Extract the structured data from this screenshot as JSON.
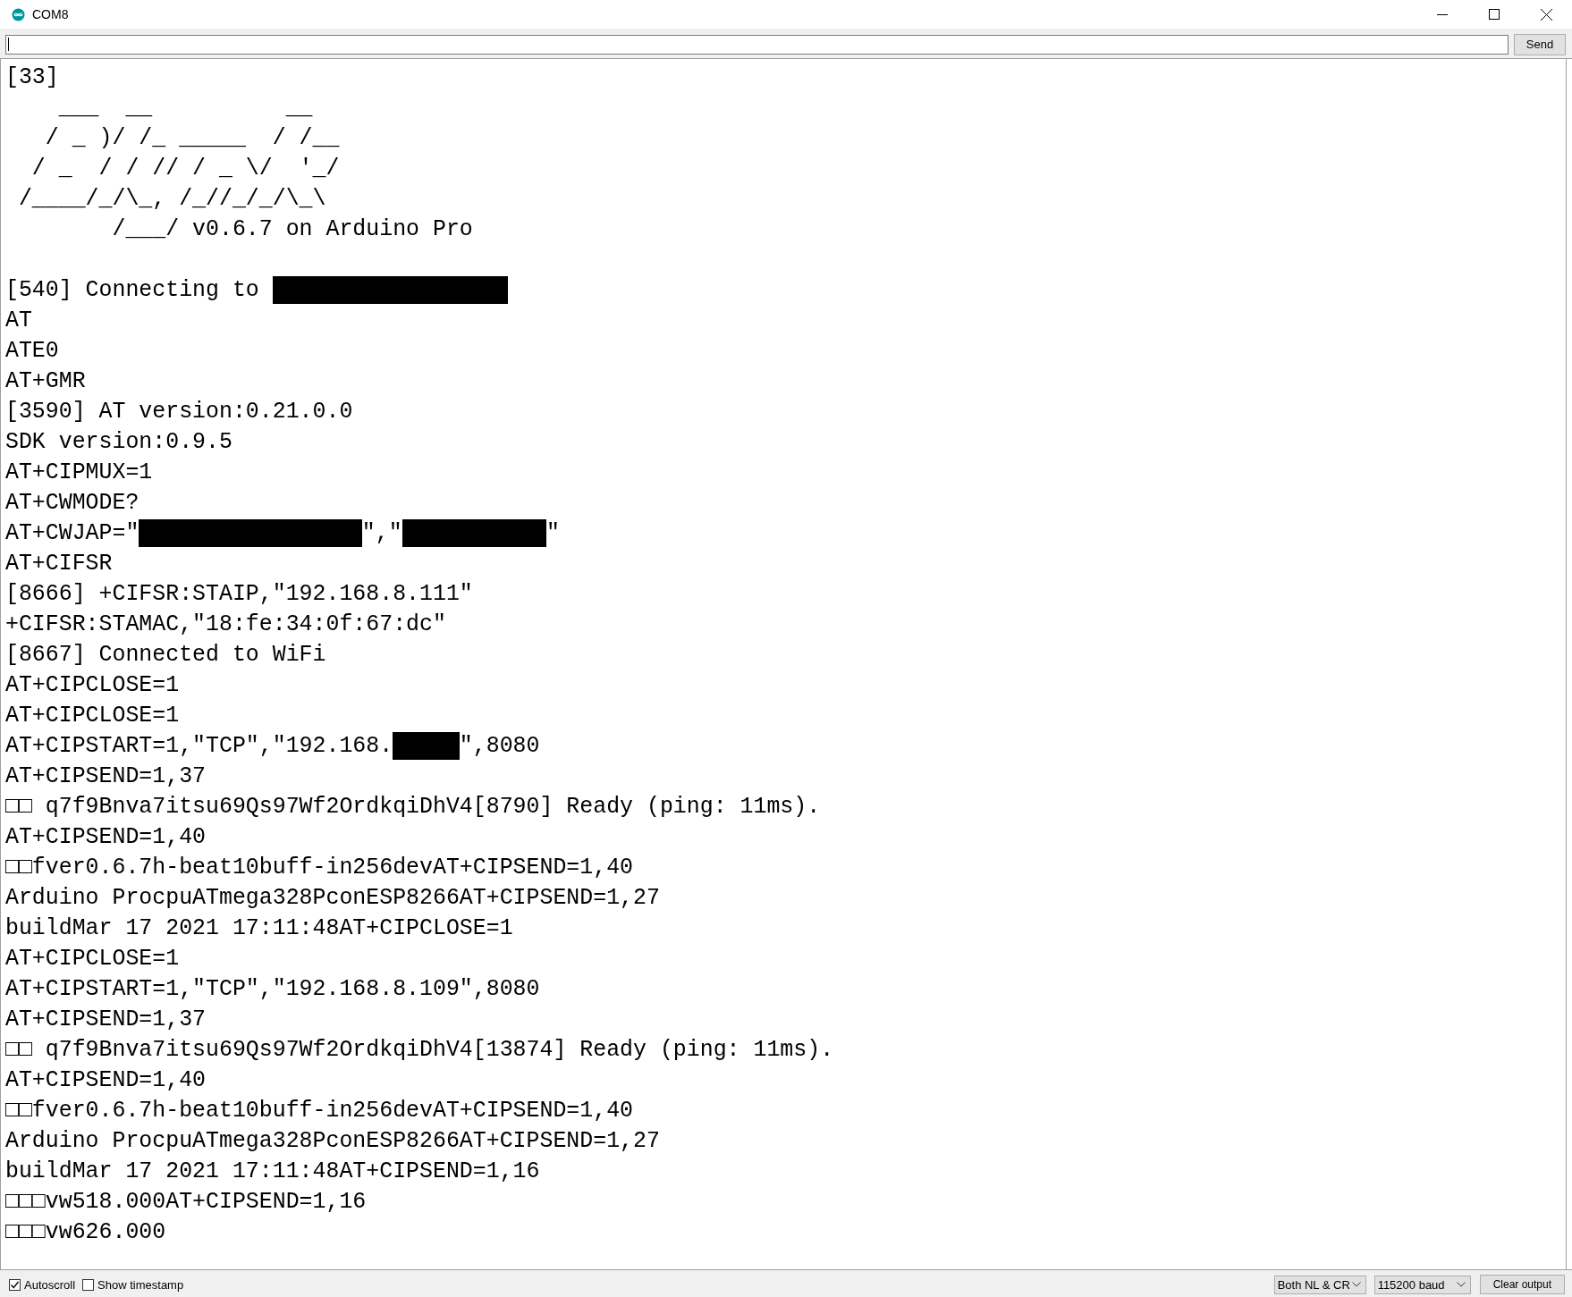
{
  "window": {
    "title": "COM8"
  },
  "send_button": "Send",
  "output": {
    "lines": [
      "[33]",
      "    ___  __          __",
      "   / _ )/ /_ _____  / /__",
      "  / _  / / // / _ \\/  '_/",
      " /____/_/\\_, /_//_/_/\\_\\",
      "        /___/ v0.6.7 on Arduino Pro",
      {
        "kind": "blank"
      },
      {
        "parts": [
          {
            "kind": "text",
            "text": "[540] Connecting to "
          },
          {
            "kind": "redacted"
          }
        ]
      },
      "AT",
      "ATE0",
      "AT+GMR",
      "[3590] AT version:0.21.0.0",
      "SDK version:0.9.5",
      "AT+CIPMUX=1",
      "AT+CWMODE?",
      {
        "parts": [
          {
            "kind": "text",
            "text": "AT+CWJAP=\""
          },
          {
            "kind": "redacted"
          },
          {
            "kind": "text",
            "text": "\",\""
          },
          {
            "kind": "redacted"
          },
          {
            "kind": "text",
            "text": "\""
          }
        ]
      },
      "AT+CIFSR",
      "[8666] +CIFSR:STAIP,\"192.168.8.111\"",
      "+CIFSR:STAMAC,\"18:fe:34:0f:67:dc\"",
      "[8667] Connected to WiFi",
      "AT+CIPCLOSE=1",
      "AT+CIPCLOSE=1",
      {
        "parts": [
          {
            "kind": "text",
            "text": "AT+CIPSTART=1,\"TCP\",\"192.168."
          },
          {
            "kind": "redacted"
          },
          {
            "kind": "text",
            "text": "\",8080"
          }
        ]
      },
      "AT+CIPSEND=1,37",
      "□□ q7f9Bnva7itsu69Qs97Wf2OrdkqiDhV4[8790] Ready (ping: 11ms).",
      "AT+CIPSEND=1,40",
      "□□fver0.6.7h-beat10buff-in256devAT+CIPSEND=1,40",
      "Arduino ProcpuATmega328PconESP8266AT+CIPSEND=1,27",
      "buildMar 17 2021 17:11:48AT+CIPCLOSE=1",
      "AT+CIPCLOSE=1",
      "AT+CIPSTART=1,\"TCP\",\"192.168.8.109\",8080",
      "AT+CIPSEND=1,37",
      "□□ q7f9Bnva7itsu69Qs97Wf2OrdkqiDhV4[13874] Ready (ping: 11ms).",
      "AT+CIPSEND=1,40",
      "□□fver0.6.7h-beat10buff-in256devAT+CIPSEND=1,40",
      "Arduino ProcpuATmega328PconESP8266AT+CIPSEND=1,27",
      "buildMar 17 2021 17:11:48AT+CIPSEND=1,16",
      "□□□vw518.000AT+CIPSEND=1,16",
      "□□□vw626.000"
    ]
  },
  "footer": {
    "autoscroll": {
      "label": "Autoscroll",
      "checked": true
    },
    "timestamp": {
      "label": "Show timestamp",
      "checked": false
    },
    "line_ending": "Both NL & CR",
    "baud": "115200 baud",
    "clear_button": "Clear output"
  }
}
